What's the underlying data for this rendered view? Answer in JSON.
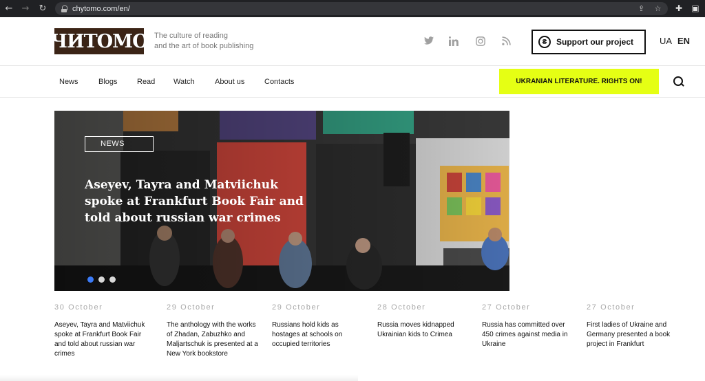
{
  "browser": {
    "url": "chytomo.com/en/",
    "icons": [
      "back-arrow-icon",
      "forward-arrow-icon",
      "reload-icon",
      "lock-icon",
      "share-icon",
      "bookmark-star-icon",
      "extensions-icon",
      "sidebar-icon"
    ]
  },
  "header": {
    "logo_text": "ЧИТОМО",
    "tagline_line1": "The culture of reading",
    "tagline_line2": "and the art of book publishing",
    "social": [
      "twitter-icon",
      "linkedin-icon",
      "instagram-icon",
      "rss-icon"
    ],
    "support_label": "Support our project",
    "lang_ua": "UA",
    "lang_en": "EN"
  },
  "nav": {
    "items": [
      "News",
      "Blogs",
      "Read",
      "Watch",
      "About us",
      "Contacts"
    ],
    "cta": "UKRANIAN LITERATURE. RIGHTS ON!"
  },
  "hero": {
    "tag": "NEWS",
    "title": "Aseyev, Tayra and Matviichuk spoke at Frankfurt Book Fair and told about russian war crimes",
    "slides": 3,
    "active_slide": 1,
    "colors": {
      "accent_dot": "#3b7bf7",
      "cta": "#e5ff14"
    }
  },
  "news": [
    {
      "date": "30 October",
      "text": "Aseyev, Tayra and Matviichuk spoke at Frankfurt Book Fair and told about russian war crimes"
    },
    {
      "date": "29 October",
      "text": "The anthology with the works of Zhadan, Zabuzhko and Maljartschuk is presented at a New York bookstore"
    },
    {
      "date": "29 October",
      "text": "Russians hold kids as hostages at schools on occupied territories"
    },
    {
      "date": "28 October",
      "text": "Russia moves kidnapped Ukrainian kids to Crimea"
    },
    {
      "date": "27 October",
      "text": "Russia has committed over 450 crimes against media in Ukraine"
    },
    {
      "date": "27 October",
      "text": "First ladies of Ukraine and Germany presented a book project in Frankfurt"
    }
  ]
}
